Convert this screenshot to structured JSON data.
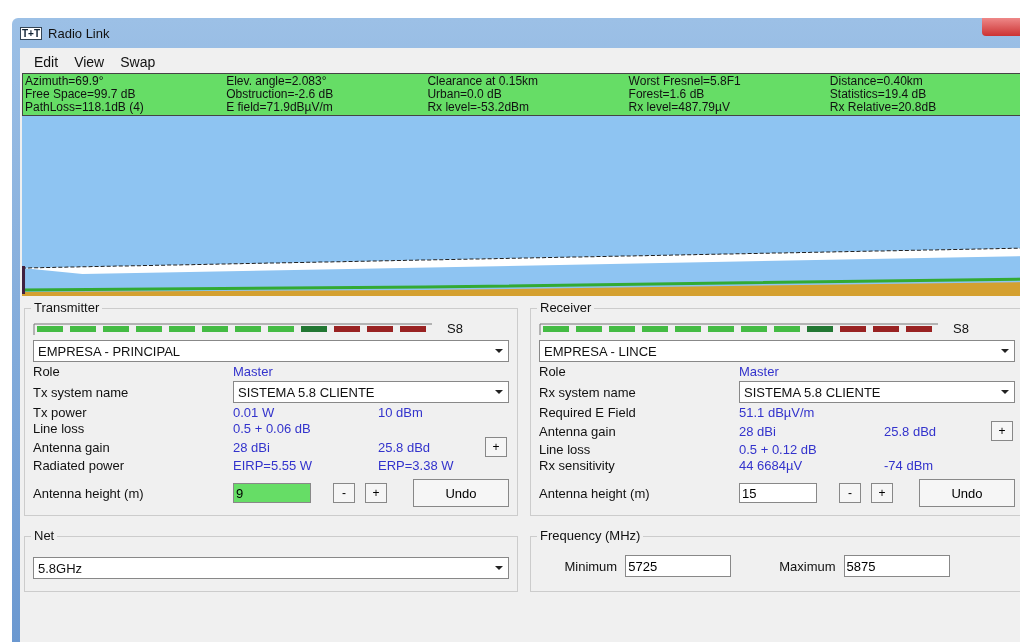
{
  "window": {
    "title": "Radio Link",
    "logo": "T+T"
  },
  "menu": [
    {
      "label": "Edit"
    },
    {
      "label": "View"
    },
    {
      "label": "Swap"
    }
  ],
  "info": [
    [
      "Azimuth=69.9°",
      "Elev. angle=2.083°",
      "Clearance at 0.15km",
      "Worst Fresnel=5.8F1",
      "Distance=0.40km"
    ],
    [
      "Free Space=99.7 dB",
      "Obstruction=-2.6 dB",
      "Urban=0.0 dB",
      "Forest=1.6 dB",
      "Statistics=19.4 dB"
    ],
    [
      "PathLoss=118.1dB (4)",
      "E field=71.9dBµV/m",
      "Rx level=-53.2dBm",
      "Rx level=487.79µV",
      "Rx Relative=20.8dB"
    ]
  ],
  "panels": [
    {
      "title": "Transmitter",
      "reading": "S8",
      "site": "EMPRESA - PRINCIPAL",
      "rows": [
        {
          "kind": "text",
          "label": "Role",
          "value": "Master"
        },
        {
          "kind": "select",
          "label": "Tx system name",
          "value": "SISTEMA 5.8 CLIENTE"
        },
        {
          "kind": "pair",
          "label": "Tx power",
          "value": "0.01 W",
          "value2": "10 dBm"
        },
        {
          "kind": "text",
          "label": "Line loss",
          "value": "0.5 + 0.06 dB"
        },
        {
          "kind": "pair",
          "label": "Antenna gain",
          "value": "28 dBi",
          "value2": "25.8 dBd",
          "button": "+"
        },
        {
          "kind": "pair",
          "label": "Radiated power",
          "value": "EIRP=5.55 W",
          "value2": "ERP=3.38 W"
        }
      ],
      "height": {
        "label": "Antenna height (m)",
        "value": "9",
        "selected": true,
        "minus": "-",
        "plus": "+",
        "undo": "Undo"
      }
    },
    {
      "title": "Receiver",
      "reading": "S8",
      "site": "EMPRESA - LINCE",
      "rows": [
        {
          "kind": "text",
          "label": "Role",
          "value": "Master"
        },
        {
          "kind": "select",
          "label": "Rx system name",
          "value": "SISTEMA 5.8 CLIENTE"
        },
        {
          "kind": "text",
          "label": "Required E Field",
          "value": "51.1 dBµV/m"
        },
        {
          "kind": "pair",
          "label": "Antenna gain",
          "value": "28 dBi",
          "value2": "25.8 dBd",
          "button": "+"
        },
        {
          "kind": "text",
          "label": "Line loss",
          "value": "0.5 + 0.12 dB"
        },
        {
          "kind": "pair",
          "label": "Rx sensitivity",
          "value": "44 6684µV",
          "value2": "-74 dBm"
        }
      ],
      "height": {
        "label": "Antenna height (m)",
        "value": "15",
        "selected": false,
        "minus": "-",
        "plus": "+",
        "undo": "Undo"
      }
    }
  ],
  "net": {
    "title": "Net",
    "value": "5.8GHz"
  },
  "frequency": {
    "title": "Frequency (MHz)",
    "minimum_label": "Minimum",
    "minimum": "5725",
    "maximum_label": "Maximum",
    "maximum": "5875"
  }
}
